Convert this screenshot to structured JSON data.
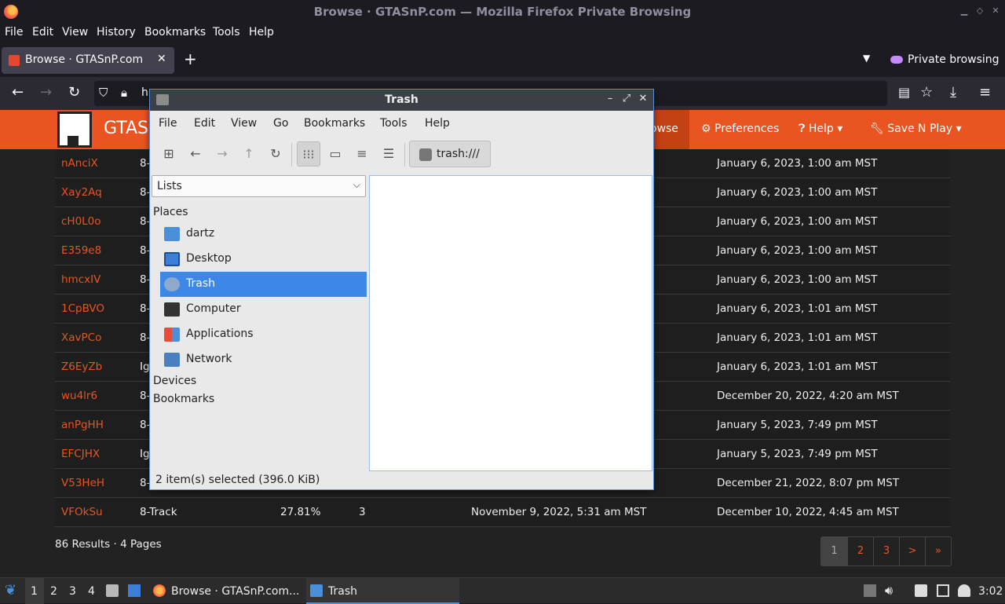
{
  "browser": {
    "window_title": "Browse · GTASnP.com — Mozilla Firefox Private Browsing",
    "menu": [
      "File",
      "Edit",
      "View",
      "History",
      "Bookmarks",
      "Tools",
      "Help"
    ],
    "tab_label": "Browse · GTASnP.com",
    "private_label": "Private browsing",
    "url_partial": "h"
  },
  "site": {
    "brand": "GTASr",
    "nav": {
      "browse": "owse",
      "preferences": "Preferences",
      "help": "Help ▾",
      "save_n_play": "Save N Play ▾"
    },
    "rows": [
      {
        "name": "nAnciX",
        "c2": "8-",
        "c3": "",
        "c4": "",
        "c5": "",
        "c6": "January 6, 2023, 1:00 am MST"
      },
      {
        "name": "Xay2Aq",
        "c2": "8-",
        "c3": "",
        "c4": "",
        "c5": "",
        "c6": "January 6, 2023, 1:00 am MST"
      },
      {
        "name": "cH0L0o",
        "c2": "8-",
        "c3": "",
        "c4": "",
        "c5": "",
        "c6": "January 6, 2023, 1:00 am MST"
      },
      {
        "name": "E359e8",
        "c2": "8-",
        "c3": "",
        "c4": "",
        "c5": "",
        "c6": "January 6, 2023, 1:00 am MST"
      },
      {
        "name": "hmcxIV",
        "c2": "8-",
        "c3": "",
        "c4": "",
        "c5": "",
        "c6": "January 6, 2023, 1:00 am MST"
      },
      {
        "name": "1CpBVO",
        "c2": "8-",
        "c3": "",
        "c4": "",
        "c5": "",
        "c6": "January 6, 2023, 1:01 am MST"
      },
      {
        "name": "XavPCo",
        "c2": "8-",
        "c3": "",
        "c4": "",
        "c5": "",
        "c6": "January 6, 2023, 1:01 am MST"
      },
      {
        "name": "Z6EyZb",
        "c2": "Ig",
        "c3": "",
        "c4": "",
        "c5": "",
        "c6": "January 6, 2023, 1:01 am MST"
      },
      {
        "name": "wu4lr6",
        "c2": "8-",
        "c3": "",
        "c4": "",
        "c5": "",
        "c6": "December 20, 2022, 4:20 am MST"
      },
      {
        "name": "anPgHH",
        "c2": "8-",
        "c3": "",
        "c4": "",
        "c5": "",
        "c6": "January 5, 2023, 7:49 pm MST"
      },
      {
        "name": "EFCJHX",
        "c2": "Ig",
        "c3": "",
        "c4": "",
        "c5": "",
        "c6": "January 5, 2023, 7:49 pm MST"
      },
      {
        "name": "V53HeH",
        "c2": "8-",
        "c3": "",
        "c4": "",
        "c5": "",
        "c6": "December 21, 2022, 8:07 pm MST"
      },
      {
        "name": "VFOkSu",
        "c2": "8-Track",
        "c3": "27.81%",
        "c4": "3",
        "c5": "November 9, 2022, 5:31 am MST",
        "c6": "December 10, 2022, 4:45 am MST"
      }
    ],
    "results": "86 Results · 4 Pages",
    "pager": [
      "1",
      "2",
      "3",
      ">",
      "»"
    ]
  },
  "trash": {
    "title": "Trash",
    "menu": [
      "File",
      "Edit",
      "View",
      "Go",
      "Bookmarks",
      "Tools",
      "Help"
    ],
    "location": "trash:///",
    "side_combo": "Lists",
    "places_header": "Places",
    "places": [
      "dartz",
      "Desktop",
      "Trash",
      "Computer",
      "Applications",
      "Network"
    ],
    "devices_header": "Devices",
    "bookmarks_header": "Bookmarks",
    "status": "2 item(s) selected (396.0 KiB)"
  },
  "taskbar": {
    "workspaces": [
      "1",
      "2",
      "3",
      "4"
    ],
    "firefox_task": "Browse · GTASnP.com...",
    "trash_task": "Trash",
    "clock": "3:02"
  }
}
